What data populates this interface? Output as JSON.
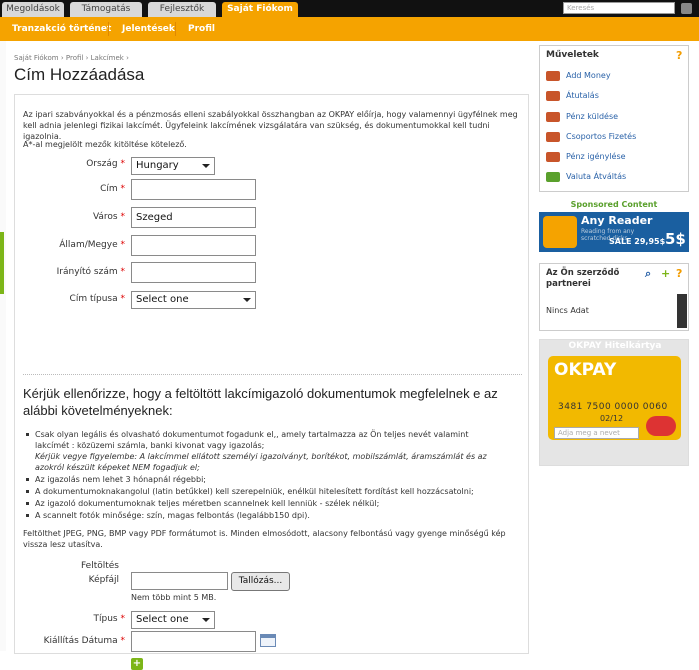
{
  "topnav": {
    "tabs": [
      {
        "label": "Megoldások"
      },
      {
        "label": "Támogatás"
      },
      {
        "label": "Fejlesztők"
      },
      {
        "label": "Saját Fiókom"
      }
    ],
    "search_placeholder": "Keresés"
  },
  "subnav": {
    "items": [
      {
        "label": "Tranzakció történet"
      },
      {
        "label": "Jelentések"
      },
      {
        "label": "Profil"
      }
    ]
  },
  "breadcrumb": {
    "items": [
      "Saját Fiókom",
      "Profil",
      "Lakcímek"
    ],
    "sep": "›"
  },
  "page_title": "Cím Hozzáadása",
  "intro": "Az ipari szabványokkal és a pénzmosás elleni szabályokkal összhangban az OKPAY előírja, hogy valamennyi ügyfélnek meg kell adnia jelenlegi fizikai lakcímét. Ügyfeleink lakcímének vizsgálatára van szükség, és dokumentumokkal kell tudni igazolnia.",
  "required_note": "A*-al megjelölt mezők kitöltése kötelező.",
  "form": {
    "country_label": "Ország",
    "country_value": "Hungary",
    "address_label": "Cím",
    "address_value": "",
    "city_label": "Város",
    "city_value": "Szeged",
    "state_label": "Állam/Megye",
    "state_value": "",
    "zip_label": "Irányító szám",
    "zip_value": "",
    "address_type_label": "Cím típusa",
    "address_type_value": "Select one",
    "req_mark": "*"
  },
  "doc_heading": "Kérjük ellenőrizze, hogy a feltöltött lakcímigazoló dokumentumok megfelelnek e az alábbi követelményeknek:",
  "requirements": [
    {
      "text": "Csak olyan legális és olvasható dokumentumot fogadunk el,, amely tartalmazza az Ön teljes  nevét valamint"
    },
    {
      "text": "lakcímét : közüzemi számla, banki kivonat vagy igazolás;"
    },
    {
      "text": "Kérjük vegye figyelembe: A lakcímmel ellátott személyi igazolványt, borítékot, mobilszámlát, áramszámlát és az"
    },
    {
      "text": "azokról készült képeket NEM fogadjuk el;"
    },
    {
      "text": "Az igazolás nem lehet 3 hónapnál régebbi;"
    },
    {
      "text": "A dokumentumoknakangolul (latin betűkkel) kell szerepelniük, enélkül hitelesített fordítást kell hozzácsatolni;"
    },
    {
      "text": "Az igazoló dokumentumoknak teljes méretben scannelnek kell lenniük - szélek nélkül;"
    },
    {
      "text": "A scannelt fotók minősége: szín, magas felbontás (legalább150 dpi)."
    }
  ],
  "upload_note": "Feltölthet JPEG, PNG, BMP vagy PDF formátumot is. Minden elmosódott, alacsony felbontású vagy gyenge minőségű kép vissza lesz utasítva.",
  "upload": {
    "label_line1": "Feltöltés",
    "label_line2": "Képfájl",
    "browse_label": "Tallózás...",
    "size_note": "Nem több mint 5 MB.",
    "type_label": "Típus",
    "type_value": "Select one",
    "date_label": "Kiállítás Dátuma",
    "date_value": ""
  },
  "sidebar": {
    "actions_title": "Műveletek",
    "actions": [
      {
        "label": "Add Money"
      },
      {
        "label": "Átutalás"
      },
      {
        "label": "Pénz küldése"
      },
      {
        "label": "Csoportos Fizetés"
      },
      {
        "label": "Pénz igénylése"
      },
      {
        "label": "Valuta Átváltás"
      }
    ],
    "sponsored_title": "Sponsored Content",
    "banner": {
      "title": "Any Reader",
      "subtitle": "Reading from any scratched disks",
      "sale": "SALE 29,95$",
      "price": "5$"
    },
    "partners_title": "Az Ön szerződő partnerei",
    "partners_empty": "Nincs Adat",
    "credit_title": "OKPAY Hitelkártya",
    "card": {
      "logo": "OKPAY",
      "number": "3481 7500 0000 0060",
      "expiry": "02/12"
    },
    "name_placeholder": "Adja meg a nevet"
  },
  "colors": {
    "accent": "#f5a300",
    "link": "#2a62a8",
    "green": "#7cb518"
  }
}
